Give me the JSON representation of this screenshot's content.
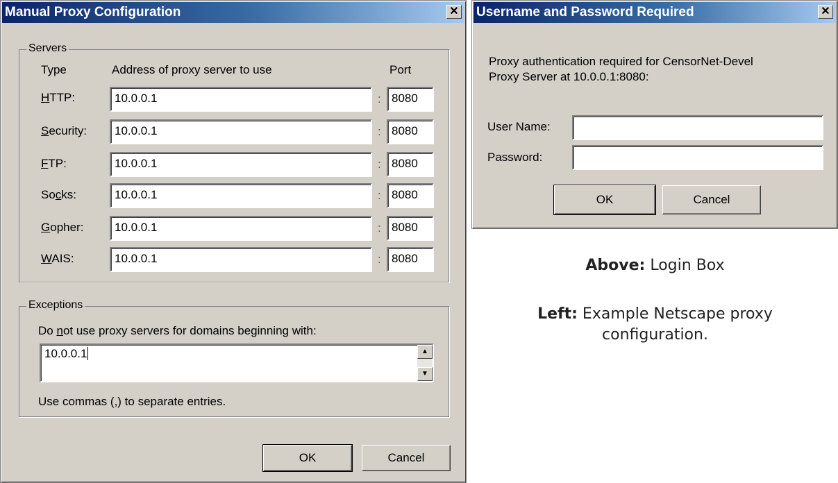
{
  "proxy_dialog": {
    "title": "Manual Proxy Configuration",
    "close_glyph": "✕",
    "servers_group": "Servers",
    "col_type": "Type",
    "col_address": "Address of proxy server to use",
    "col_port": "Port",
    "rows": [
      {
        "label_pre": "",
        "label_u": "H",
        "label_post": "TTP:",
        "address": "10.0.0.1",
        "port": "8080"
      },
      {
        "label_pre": "",
        "label_u": "S",
        "label_post": "ecurity:",
        "address": "10.0.0.1",
        "port": "8080"
      },
      {
        "label_pre": "",
        "label_u": "F",
        "label_post": "TP:",
        "address": "10.0.0.1",
        "port": "8080"
      },
      {
        "label_pre": "So",
        "label_u": "c",
        "label_post": "ks:",
        "address": "10.0.0.1",
        "port": "8080"
      },
      {
        "label_pre": "",
        "label_u": "G",
        "label_post": "opher:",
        "address": "10.0.0.1",
        "port": "8080"
      },
      {
        "label_pre": "",
        "label_u": "W",
        "label_post": "AIS:",
        "address": "10.0.0.1",
        "port": "8080"
      }
    ],
    "colon": ":",
    "exceptions_group": "Exceptions",
    "exceptions_label_pre": "Do ",
    "exceptions_label_u": "n",
    "exceptions_label_post": "ot use proxy servers for domains beginning with:",
    "exceptions_value": "10.0.0.1",
    "exceptions_hint": "Use commas (,) to separate entries.",
    "ok_label": "OK",
    "cancel_label": "Cancel"
  },
  "login_dialog": {
    "title": "Username and Password Required",
    "close_glyph": "✕",
    "message_line1": "Proxy authentication required for CensorNet-Devel",
    "message_line2": "Proxy Server at 10.0.0.1:8080:",
    "username_label": "User Name:",
    "password_label": "Password:",
    "username_value": "",
    "password_value": "",
    "ok_label": "OK",
    "cancel_label": "Cancel"
  },
  "captions": {
    "above_bold": "Above:",
    "above_text": " Login Box",
    "left_bold": "Left:",
    "left_text_line1": " Example Netscape proxy",
    "left_text_line2": "configuration."
  },
  "colors": {
    "dialog_face": "#d4d0c8",
    "titlebar_start": "#0a246a",
    "titlebar_end": "#a6caf0"
  }
}
